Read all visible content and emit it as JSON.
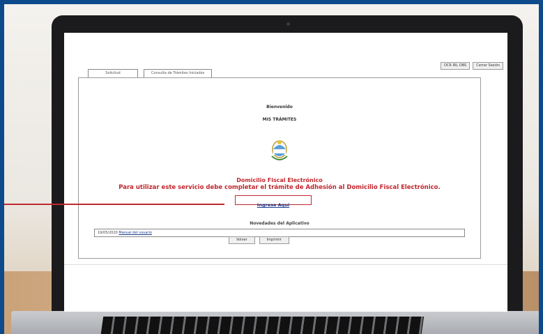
{
  "top_buttons": [
    "OCR IRL OBS",
    "Cerrar Sesión"
  ],
  "tabs": [
    "Solicitud",
    "Consulta de Trámites Iniciados"
  ],
  "welcome": "Bienvenido",
  "section_title": "MIS TRÁMITES",
  "domicilio_title": "Domicilio Fiscal Electrónico",
  "domicilio_message": "Para utilizar este servicio debe completar el trámite de Adhesión al Domicilio Fiscal Electrónico.",
  "ingrese_link": "Ingrese Aquí",
  "novedades_title": "Novedades del Aplicativo",
  "news": {
    "date": "19/05/2020",
    "link": "Manual del usuario"
  },
  "bottom_buttons": [
    "Volver",
    "Imprimir"
  ],
  "colors": {
    "frame": "#0d4a8c",
    "accent_red": "#c0282f",
    "link_blue": "#1a3a8a"
  }
}
